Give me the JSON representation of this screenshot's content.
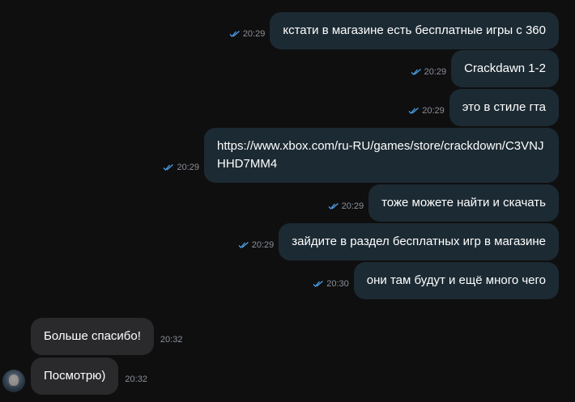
{
  "colors": {
    "background": "#0f0f10",
    "outgoing_bubble": "#1c2a33",
    "incoming_bubble": "#2a2a2c",
    "read_ticks": "#4a9fe8",
    "timestamp": "#8a8f98"
  },
  "messages": [
    {
      "direction": "out",
      "text": "кстати в магазине есть бесплатные игры с 360",
      "time": "20:29",
      "status_icon": "double-check-icon"
    },
    {
      "direction": "out",
      "text": "Crackdawn 1-2",
      "time": "20:29",
      "status_icon": "double-check-icon"
    },
    {
      "direction": "out",
      "text": "это в стиле гта",
      "time": "20:29",
      "status_icon": "double-check-icon"
    },
    {
      "direction": "out",
      "text": "https://www.xbox.com/ru-RU/games/store/crackdown/C3VNJHHD7MM4",
      "time": "20:29",
      "status_icon": "double-check-icon"
    },
    {
      "direction": "out",
      "text": "тоже можете найти и скачать",
      "time": "20:29",
      "status_icon": "double-check-icon"
    },
    {
      "direction": "out",
      "text": "зайдите в раздел бесплатных игр в магазине",
      "time": "20:29",
      "status_icon": "double-check-icon"
    },
    {
      "direction": "out",
      "text": "они там будут и ещё много чего",
      "time": "20:30",
      "status_icon": "double-check-icon"
    },
    {
      "direction": "in",
      "text": "Больше спасибо!",
      "time": "20:32"
    },
    {
      "direction": "in",
      "text": "Посмотрю)",
      "time": "20:32"
    }
  ],
  "avatar_icon": "user-avatar-icon"
}
